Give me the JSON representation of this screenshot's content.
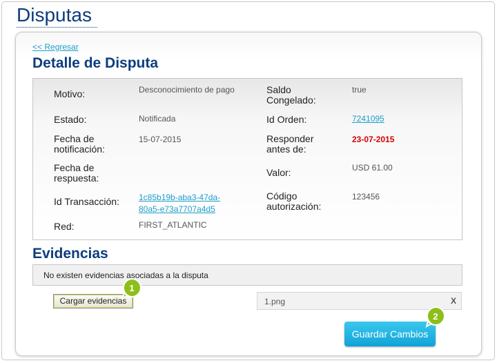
{
  "page": {
    "title": "Disputas"
  },
  "nav": {
    "back_label": "<< Regresar"
  },
  "detail": {
    "title": "Detalle de Disputa",
    "left": [
      {
        "label": "Motivo:",
        "value": "Desconocimiento de pago"
      },
      {
        "label": "Estado:",
        "value": "Notificada"
      },
      {
        "label_line1": "Fecha de",
        "label_line2": "notificación:",
        "value": "15-07-2015"
      },
      {
        "label_line1": "Fecha de",
        "label_line2": "respuesta:",
        "value": ""
      },
      {
        "label": "Id Transacción:",
        "value_line1": "1c85b19b-aba3-47da-",
        "value_line2": "80a5-e73a7707a4d5"
      },
      {
        "label": "Red:",
        "value": "FIRST_ATLANTIC"
      }
    ],
    "right": [
      {
        "label_line1": "Saldo",
        "label_line2": "Congelado:",
        "value": "true"
      },
      {
        "label": "Id Orden:",
        "value": "7241095"
      },
      {
        "label_line1": "Responder",
        "label_line2": "antes de:",
        "value": "23-07-2015"
      },
      {
        "label": "Valor:",
        "value": "USD 61.00"
      },
      {
        "label_line1": "Código",
        "label_line2": "autorización:",
        "value": "123456"
      }
    ]
  },
  "evidence": {
    "title": "Evidencias",
    "empty_message": "No existen evidencias asociadas a la disputa",
    "upload_label": "Cargar evidencias",
    "file_name": "1.png",
    "remove_label": "X"
  },
  "actions": {
    "save_label": "Guardar Cambios"
  },
  "markers": [
    {
      "number": "1"
    },
    {
      "number": "2"
    }
  ],
  "colors": {
    "title": "#0d3c7e",
    "link": "#1a9ec9",
    "alert": "#d40000",
    "save_button": "#1bb3e3",
    "marker": "#8cbf1a"
  }
}
